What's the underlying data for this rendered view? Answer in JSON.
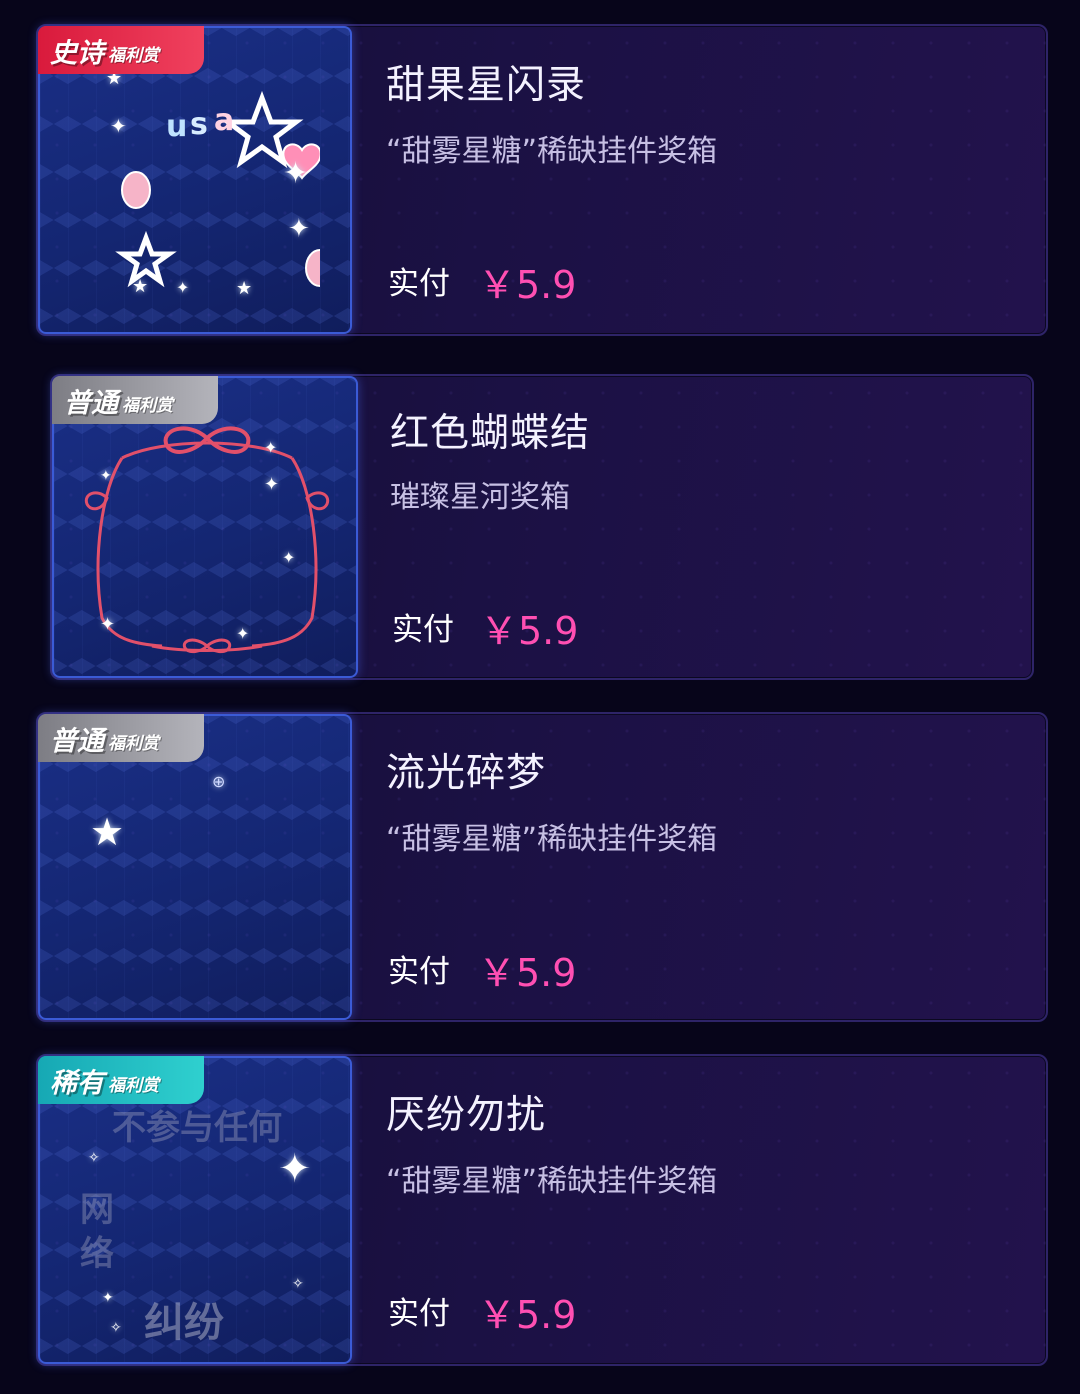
{
  "items": [
    {
      "badge_main": "史诗",
      "badge_sub": "福利赏",
      "title": "甜果星闪录",
      "subtitle": "“甜雾星糖”稀缺挂件奖箱",
      "pay_label": "实付",
      "price": "￥5.9"
    },
    {
      "badge_main": "普通",
      "badge_sub": "福利赏",
      "title": "红色蝴蝶结",
      "subtitle": "璀璨星河奖箱",
      "pay_label": "实付",
      "price": "￥5.9"
    },
    {
      "badge_main": "普通",
      "badge_sub": "福利赏",
      "title": "流光碎梦",
      "subtitle": "“甜雾星糖”稀缺挂件奖箱",
      "pay_label": "实付",
      "price": "￥5.9"
    },
    {
      "badge_main": "稀有",
      "badge_sub": "福利赏",
      "title": "厌纷勿扰",
      "subtitle": "“甜雾星糖”稀缺挂件奖箱",
      "pay_label": "实付",
      "price": "￥5.9",
      "thumb_text": [
        "不参与任何",
        "网",
        "络",
        "纠纷"
      ]
    }
  ],
  "colors": {
    "price": "#ff4fb2",
    "badge_epic": "#e52a4b",
    "badge_common": "#9a9aa1",
    "badge_rare": "#22bcc2"
  }
}
